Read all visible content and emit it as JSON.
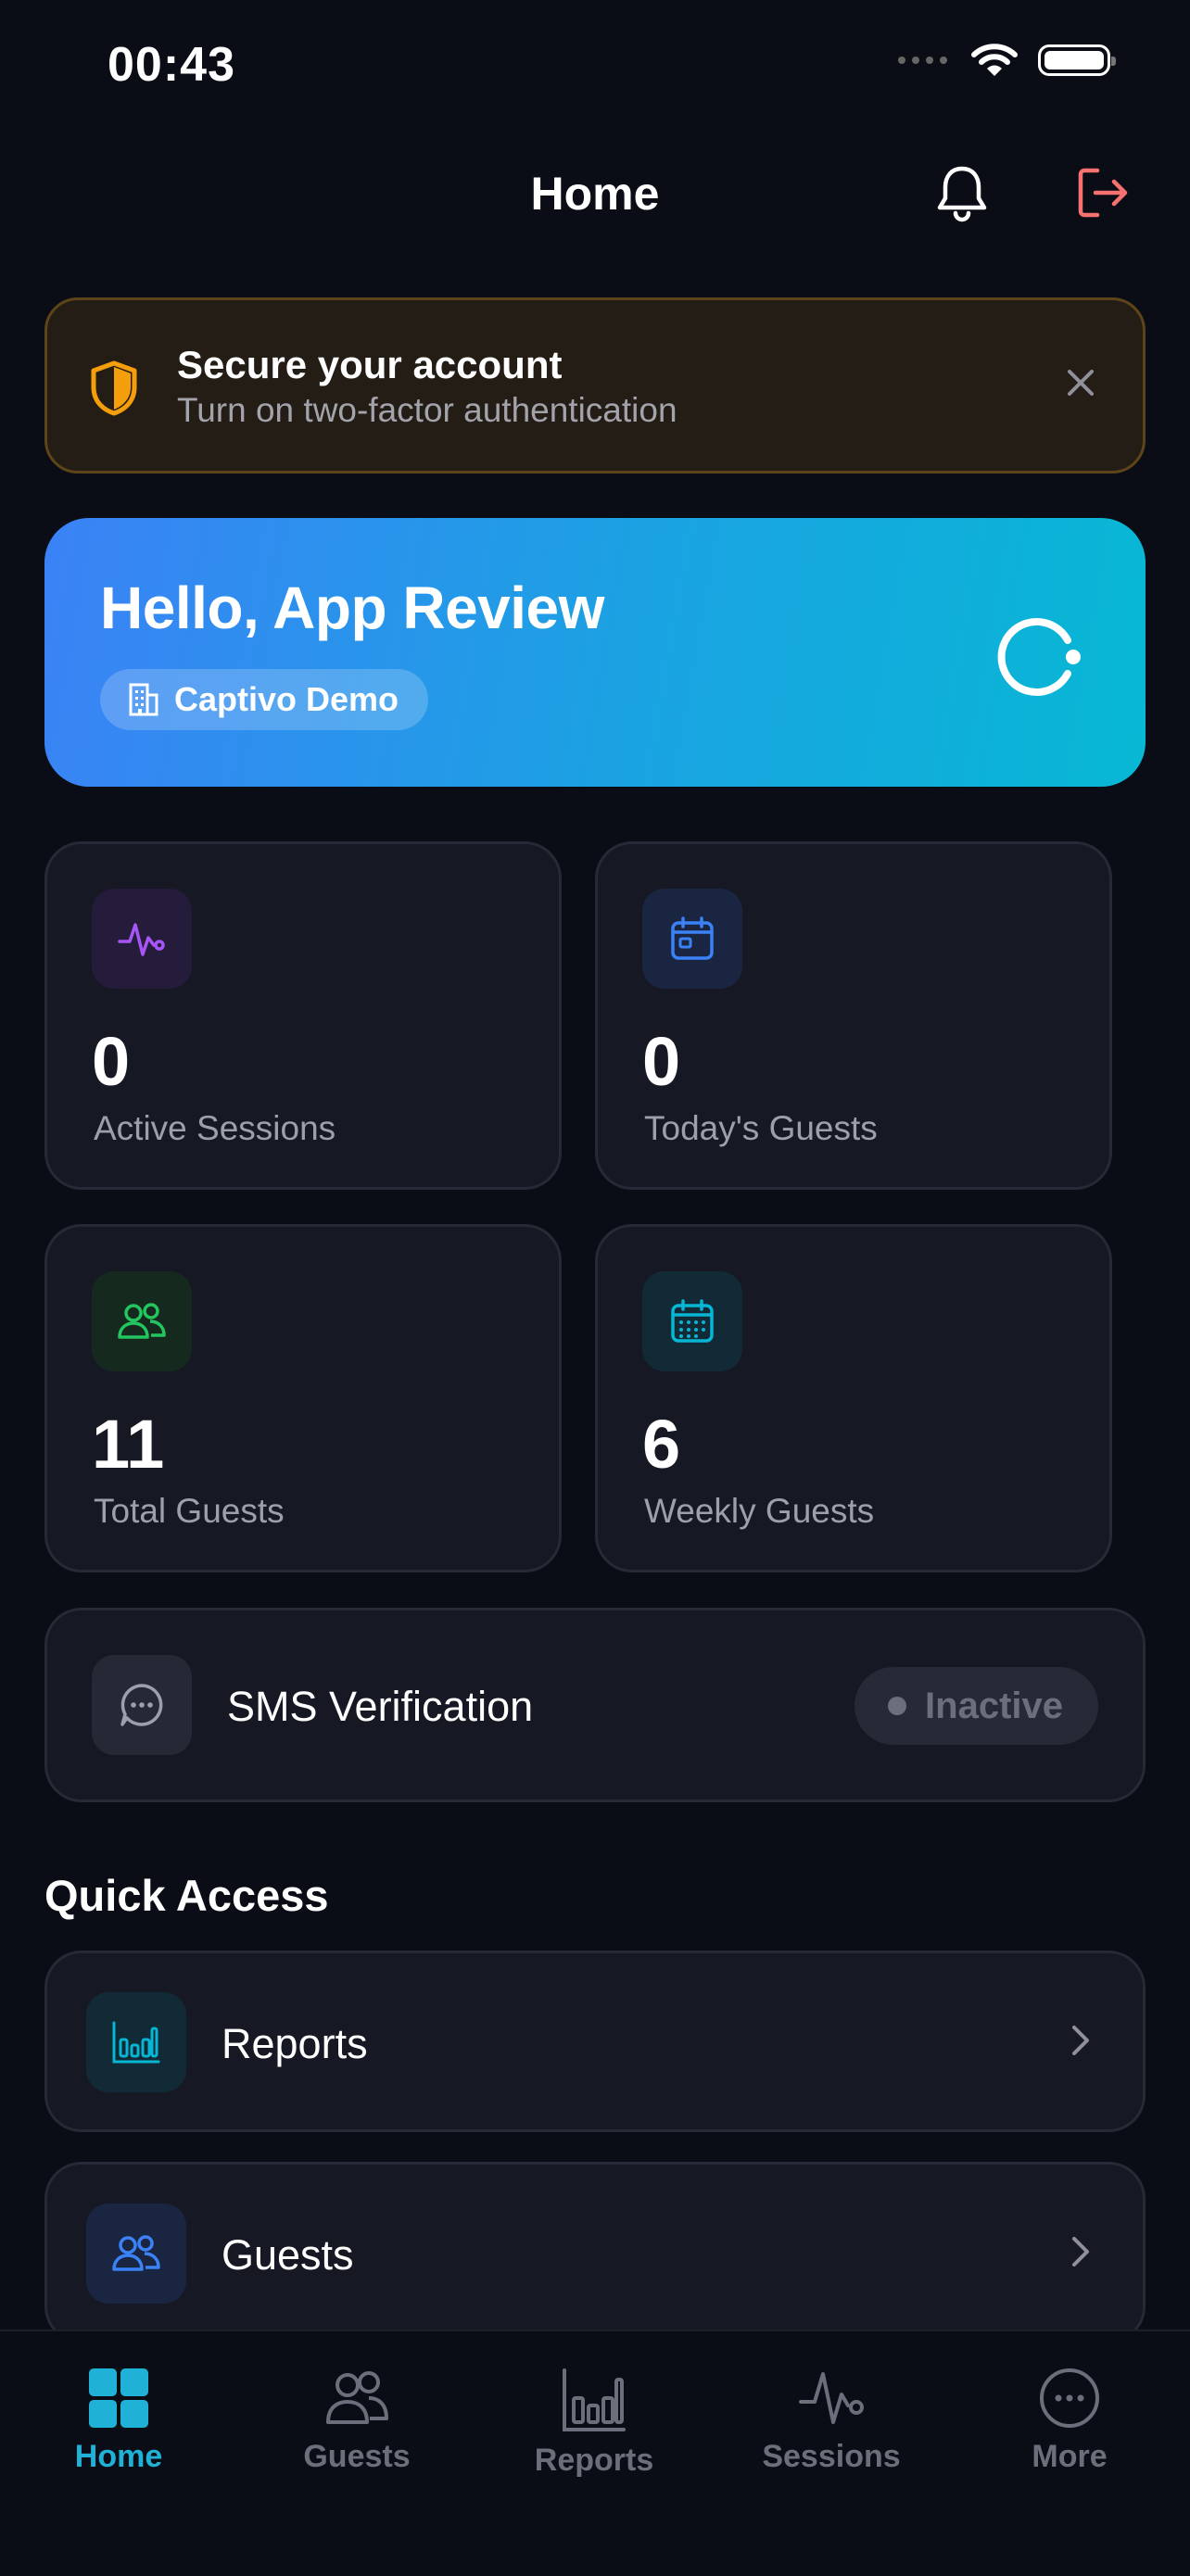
{
  "status_bar": {
    "time": "00:43"
  },
  "header": {
    "title": "Home"
  },
  "security_banner": {
    "title": "Secure your account",
    "subtitle": "Turn on two-factor authentication"
  },
  "hero": {
    "greeting": "Hello, App Review",
    "organization": "Captivo Demo"
  },
  "stats": [
    {
      "value": "0",
      "label": "Active Sessions",
      "icon": "activity-icon",
      "icon_color": "#a855f7",
      "icon_bg": "#251b3a"
    },
    {
      "value": "0",
      "label": "Today's Guests",
      "icon": "calendar-icon",
      "icon_color": "#3b82f6",
      "icon_bg": "#1a2542"
    },
    {
      "value": "11",
      "label": "Total Guests",
      "icon": "users-icon",
      "icon_color": "#22c55e",
      "icon_bg": "#15291f"
    },
    {
      "value": "6",
      "label": "Weekly Guests",
      "icon": "calendar-week-icon",
      "icon_color": "#06b6d4",
      "icon_bg": "#122a35"
    }
  ],
  "sms": {
    "label": "SMS Verification",
    "status": "Inactive"
  },
  "quick_access": {
    "title": "Quick Access",
    "items": [
      {
        "label": "Reports",
        "icon": "bar-chart-icon",
        "icon_color": "#06b6d4"
      },
      {
        "label": "Guests",
        "icon": "users-icon",
        "icon_color": "#3b82f6"
      }
    ]
  },
  "tabbar": {
    "active": "Home",
    "items": [
      {
        "label": "Home",
        "icon": "grid-icon"
      },
      {
        "label": "Guests",
        "icon": "users-icon"
      },
      {
        "label": "Reports",
        "icon": "bar-chart-icon"
      },
      {
        "label": "Sessions",
        "icon": "activity-icon"
      },
      {
        "label": "More",
        "icon": "more-icon"
      }
    ]
  },
  "colors": {
    "background": "#0b0d16",
    "card": "#161824",
    "accent": "#1fb2d6",
    "warning": "#f59e0b",
    "logout": "#f87171",
    "hero_gradient_start": "#3b82f6",
    "hero_gradient_end": "#07b8d4"
  }
}
